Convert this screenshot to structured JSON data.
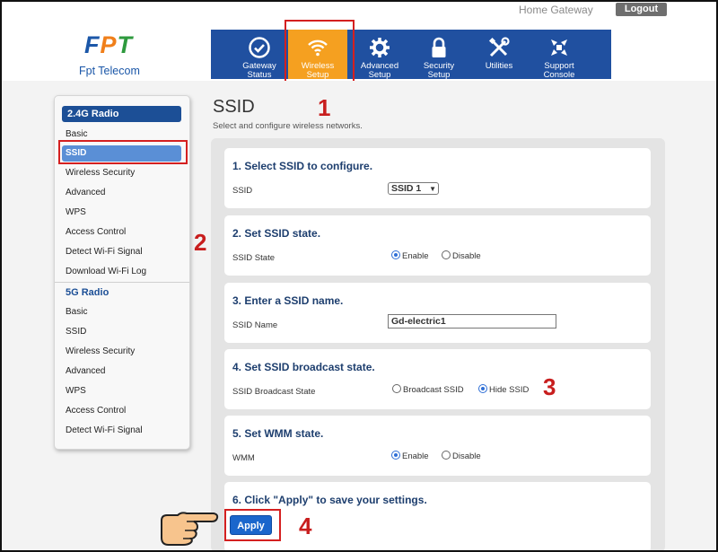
{
  "header": {
    "product_name": "Home Gateway",
    "logout_label": "Logout",
    "logo_mark": {
      "f": "F",
      "p": "P",
      "t": "T"
    },
    "logo_text": "Fpt Telecom"
  },
  "nav": {
    "items": [
      {
        "label_line1": "Gateway",
        "label_line2": "Status",
        "icon": "check-circle-icon"
      },
      {
        "label_line1": "Wireless",
        "label_line2": "Setup",
        "icon": "wifi-icon",
        "active": true
      },
      {
        "label_line1": "Advanced",
        "label_line2": "Setup",
        "icon": "gear-icon"
      },
      {
        "label_line1": "Security",
        "label_line2": "Setup",
        "icon": "lock-icon"
      },
      {
        "label_line1": "Utilities",
        "label_line2": "",
        "icon": "tools-icon"
      },
      {
        "label_line1": "Support",
        "label_line2": "Console",
        "icon": "support-icon"
      }
    ]
  },
  "sidebar": {
    "group1": "2.4G Radio",
    "group1_items": [
      "Basic",
      "SSID",
      "Wireless Security",
      "Advanced",
      "WPS",
      "Access Control",
      "Detect Wi-Fi Signal",
      "Download Wi-Fi Log"
    ],
    "group2": "5G Radio",
    "group2_items": [
      "Basic",
      "SSID",
      "Wireless Security",
      "Advanced",
      "WPS",
      "Access Control",
      "Detect Wi-Fi Signal"
    ]
  },
  "page": {
    "title": "SSID",
    "subtitle": "Select and configure wireless networks."
  },
  "sections": {
    "s1": {
      "title": "1. Select SSID to configure.",
      "label": "SSID",
      "value": "SSID 1"
    },
    "s2": {
      "title": "2. Set SSID state.",
      "label": "SSID State",
      "opt_on": "Enable",
      "opt_off": "Disable",
      "selected": "Enable"
    },
    "s3": {
      "title": "3. Enter a SSID name.",
      "label": "SSID Name",
      "value": "Gd-electric1"
    },
    "s4": {
      "title": "4. Set SSID broadcast state.",
      "label": "SSID Broadcast State",
      "opt_a": "Broadcast SSID",
      "opt_b": "Hide SSID",
      "selected": "Hide SSID"
    },
    "s5": {
      "title": "5. Set WMM state.",
      "label": "WMM",
      "opt_on": "Enable",
      "opt_off": "Disable",
      "selected": "Enable"
    },
    "s6": {
      "title": "6. Click \"Apply\" to save your settings.",
      "button": "Apply"
    }
  },
  "annotations": {
    "m1": "1",
    "m2": "2",
    "m3": "3",
    "m4": "4"
  },
  "colors": {
    "nav": "#2050a0",
    "active_tab": "#f5a020",
    "highlight": "#d42020",
    "marker": "#c81e1e"
  }
}
